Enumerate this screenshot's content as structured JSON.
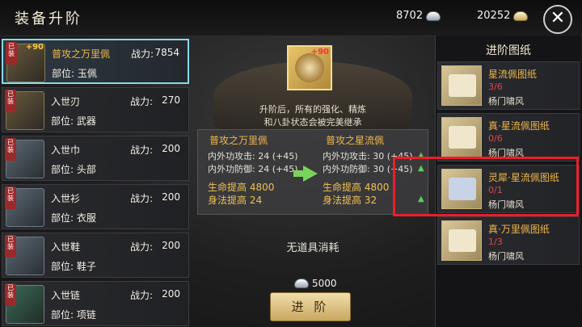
{
  "header": {
    "title": "装备升阶",
    "currency_silver": "8702",
    "currency_gold": "20252",
    "close_icon": "close-icon"
  },
  "equipment": [
    {
      "name": "普攻之万里佩",
      "power_label": "战力:",
      "power": "7854",
      "part": "部位: 玉佩",
      "plus": "+90",
      "badge": "已装"
    },
    {
      "name": "入世刃",
      "power_label": "战力:",
      "power": "270",
      "part": "部位: 武器",
      "badge": "已装"
    },
    {
      "name": "入世巾",
      "power_label": "战力:",
      "power": "200",
      "part": "部位: 头部",
      "badge": "已装"
    },
    {
      "name": "入世衫",
      "power_label": "战力:",
      "power": "200",
      "part": "部位: 衣服",
      "badge": "已装"
    },
    {
      "name": "入世鞋",
      "power_label": "战力:",
      "power": "200",
      "part": "部位: 鞋子",
      "badge": "已装"
    },
    {
      "name": "入世链",
      "power_label": "战力:",
      "power": "200",
      "part": "部位: 项链",
      "badge": "已装"
    }
  ],
  "center": {
    "target_plus": "+90",
    "notice_line1": "升阶后，所有的强化、精炼",
    "notice_line2": "和八卦状态会被完美继承",
    "current": {
      "title": "普攻之万里佩",
      "stat1": "内外功攻击: 24 (+45)",
      "stat2": "内外功防御: 24 (+45)",
      "stat3": "生命提高  4800",
      "stat4": "身法提高  24"
    },
    "next": {
      "title": "普攻之星流佩",
      "stat1": "内外功攻击: 30 (+45)",
      "stat2": "内外功防御: 30 (+45)",
      "stat3": "生命提高  4800",
      "stat4": "身法提高  32"
    },
    "no_items": "无道具消耗",
    "cost": "5000",
    "advance_label": "进 阶"
  },
  "blueprints": {
    "title": "进阶图纸",
    "items": [
      {
        "name": "星流佩图纸",
        "count": "3/6",
        "source": "杨门啸风"
      },
      {
        "name": "真·星流佩图纸",
        "count": "0/6",
        "source": "杨门啸风"
      },
      {
        "name": "灵犀·星流佩图纸",
        "count": "0/1",
        "source": "杨门啸风"
      },
      {
        "name": "真·万里佩图纸",
        "count": "1/3",
        "source": "杨门啸风"
      }
    ]
  },
  "colors": {
    "accent_gold": "#f0b84a",
    "count_red": "#d94a4a",
    "selected_border": "#8ad8e8",
    "highlight_red": "#e8202a"
  }
}
